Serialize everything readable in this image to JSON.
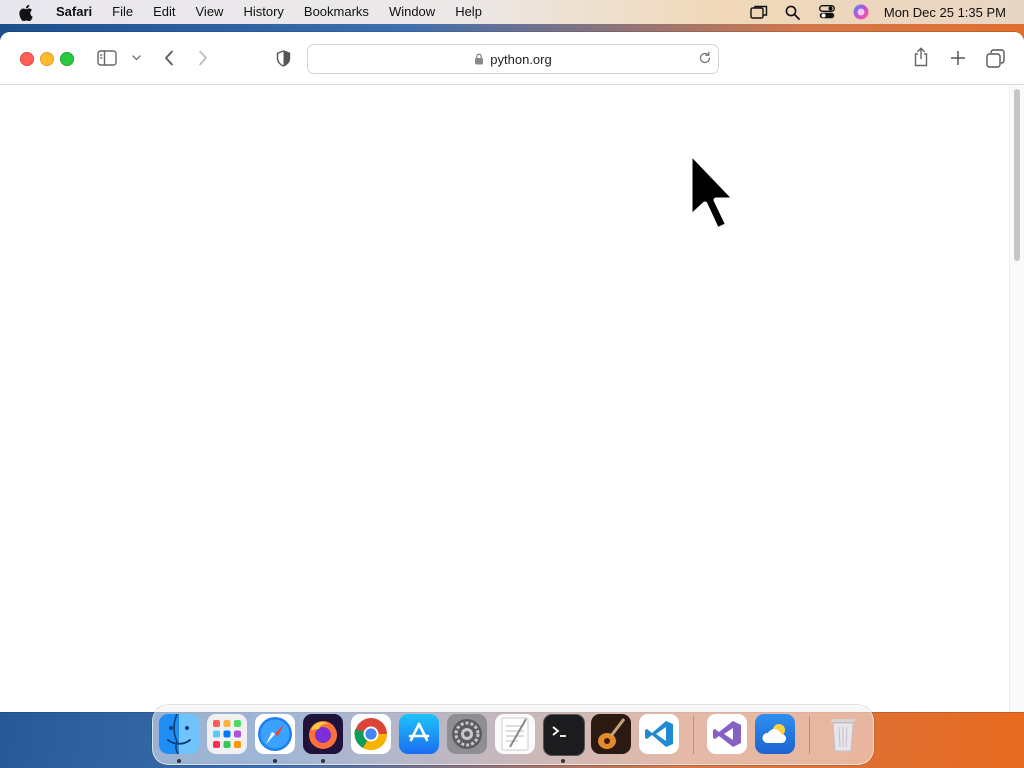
{
  "menubar": {
    "items": [
      {
        "label": "Safari"
      },
      {
        "label": "File"
      },
      {
        "label": "Edit"
      },
      {
        "label": "View"
      },
      {
        "label": "History"
      },
      {
        "label": "Bookmarks"
      },
      {
        "label": "Window"
      },
      {
        "label": "Help"
      }
    ],
    "status_icons": [
      "screen-mirror-icon",
      "spotlight-search-icon",
      "control-center-icon",
      "siri-icon"
    ],
    "clock": "Mon Dec 25  1:35 PM"
  },
  "browser": {
    "app": "Safari",
    "address": "python.org",
    "toolbar_icons": [
      "sidebar-icon",
      "chevron-down-icon",
      "back-icon",
      "forward-icon",
      "privacy-shield-icon",
      "share-icon",
      "new-tab-icon",
      "tab-overview-icon"
    ]
  },
  "dock": {
    "apps": [
      {
        "name": "Finder",
        "running": true
      },
      {
        "name": "Launchpad",
        "running": false
      },
      {
        "name": "Safari",
        "running": true
      },
      {
        "name": "Firefox",
        "running": true
      },
      {
        "name": "Chrome",
        "running": false
      },
      {
        "name": "App Store",
        "running": false
      },
      {
        "name": "System Settings",
        "running": false
      },
      {
        "name": "TextEdit",
        "running": false
      },
      {
        "name": "Terminal",
        "running": true
      },
      {
        "name": "GarageBand",
        "running": false
      },
      {
        "name": "Visual Studio Code",
        "running": false
      },
      {
        "name": "Visual Studio",
        "running": false
      },
      {
        "name": "Weather",
        "running": false
      },
      {
        "name": "Trash",
        "running": false
      }
    ]
  },
  "colors": {
    "close": "#fe5f57",
    "minimize": "#febc2e",
    "maximize": "#28c840"
  }
}
